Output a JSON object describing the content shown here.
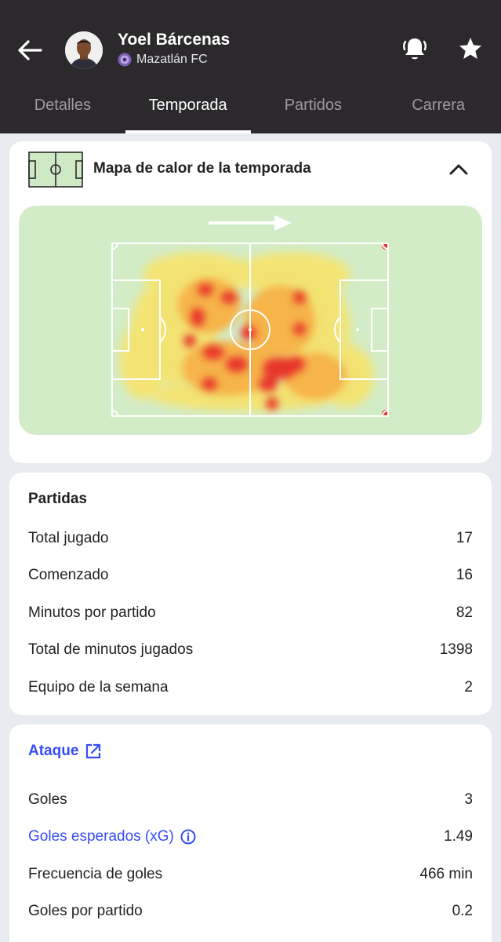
{
  "header": {
    "player_name": "Yoel Bárcenas",
    "club_name": "Mazatlán FC",
    "icons": [
      "back-arrow-icon",
      "player-avatar",
      "club-badge-icon",
      "notification-bell-icon",
      "favorite-star-icon"
    ]
  },
  "tabs": [
    {
      "label": "Detalles",
      "active": false
    },
    {
      "label": "Temporada",
      "active": true
    },
    {
      "label": "Partidos",
      "active": false
    },
    {
      "label": "Carrera",
      "active": false
    }
  ],
  "heatmap": {
    "title": "Mapa de calor de la temporada",
    "expanded": true
  },
  "partidas": {
    "title": "Partidas",
    "rows": [
      {
        "label": "Total jugado",
        "value": "17"
      },
      {
        "label": "Comenzado",
        "value": "16"
      },
      {
        "label": "Minutos por partido",
        "value": "82"
      },
      {
        "label": "Total de minutos jugados",
        "value": "1398"
      },
      {
        "label": "Equipo de la semana",
        "value": "2"
      }
    ]
  },
  "ataque": {
    "title": "Ataque",
    "rows": [
      {
        "label": "Goles",
        "value": "3"
      },
      {
        "label": "Goles esperados (xG)",
        "value": "1.49"
      },
      {
        "label": "Frecuencia de goles",
        "value": "466 min"
      },
      {
        "label": "Goles por partido",
        "value": "0.2"
      }
    ]
  },
  "colors": {
    "header_bg": "#2b292c",
    "accent_link": "#374df5",
    "pitch_bg": "#d2ecc8",
    "heat_high": "#e8352a",
    "heat_low": "#f7e36a"
  }
}
